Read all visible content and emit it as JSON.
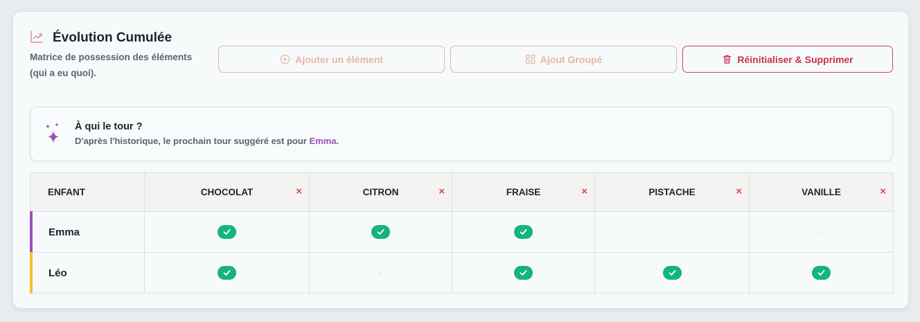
{
  "header": {
    "title": "Évolution Cumulée",
    "subtitle": "Matrice de possession des éléments (qui a eu quoi).",
    "icon": "trending-up-icon"
  },
  "toolbar": {
    "add_label": "Ajouter un élément",
    "group_add_label": "Ajout Groupé",
    "reset_label": "Réinitialiser & Supprimer"
  },
  "suggestion": {
    "title": "À qui le tour ?",
    "text_before": "D'après l'historique, le prochain tour suggéré est pour ",
    "name": "Emma",
    "text_after": "."
  },
  "table": {
    "first_header": "ENFANT",
    "columns": [
      "CHOCOLAT",
      "CITRON",
      "FRAISE",
      "PISTACHE",
      "VANILLE"
    ],
    "remove_symbol": "×",
    "empty_symbol": "-",
    "rows": [
      {
        "name": "Emma",
        "color": "#9b51b8",
        "cells": [
          true,
          true,
          true,
          false,
          false
        ]
      },
      {
        "name": "Léo",
        "color": "#f2c12e",
        "cells": [
          true,
          false,
          true,
          true,
          true
        ]
      }
    ]
  },
  "colors": {
    "accent_purple": "#9b51b8",
    "check_green": "#14b47e",
    "danger_red": "#c93148"
  }
}
